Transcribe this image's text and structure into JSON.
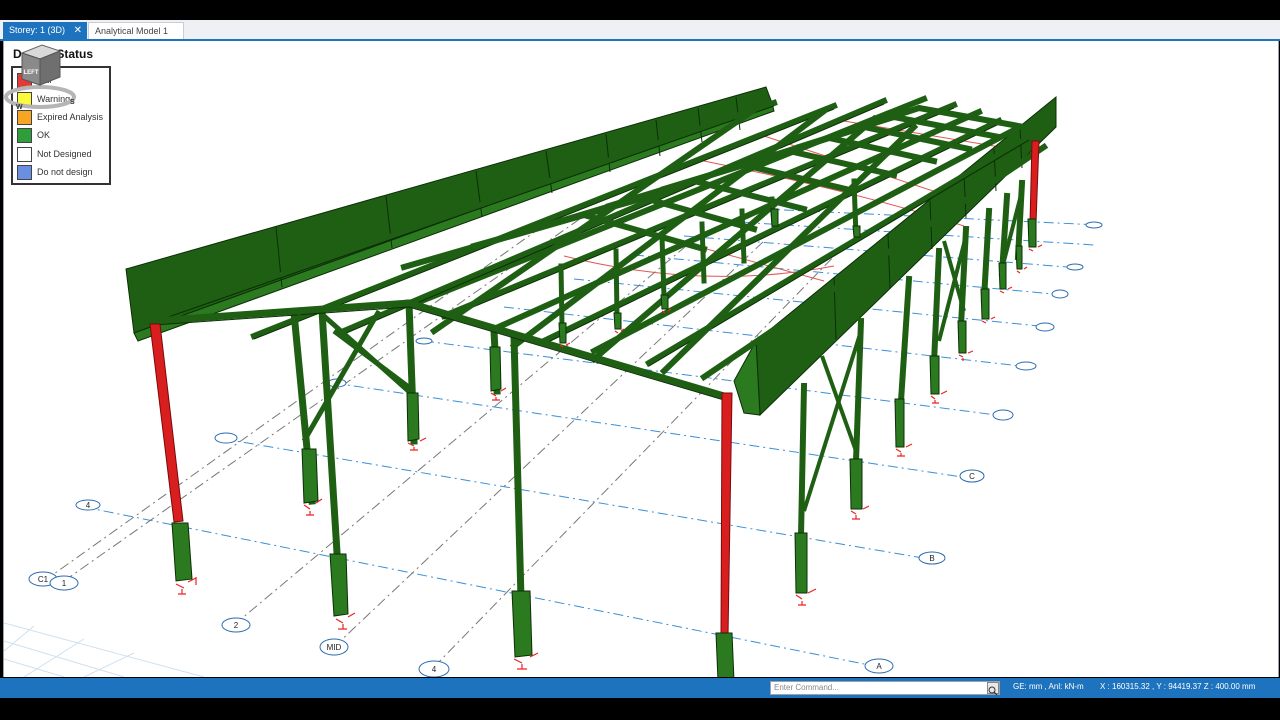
{
  "tabs": [
    {
      "label": "Storey: 1 (3D)",
      "active": true,
      "close_icon": "close-icon"
    },
    {
      "label": "Analytical Model 1",
      "active": false
    }
  ],
  "legend": {
    "title": "Design Status",
    "items": [
      {
        "label": "Fail",
        "color": "#e53935"
      },
      {
        "label": "Warning",
        "color": "#fbfb3c"
      },
      {
        "label": "Expired Analysis",
        "color": "#f6a623"
      },
      {
        "label": "OK",
        "color": "#2e9e3b"
      },
      {
        "label": "Not Designed",
        "color": "#ffffff"
      },
      {
        "label": "Do not design",
        "color": "#6b8fe0"
      }
    ]
  },
  "viewcube": {
    "face_label": "LEFT",
    "compass": [
      "W",
      "S"
    ]
  },
  "grid_labels": [
    "A",
    "B",
    "C",
    "1",
    "2",
    "4",
    "MID",
    "4",
    "C1"
  ],
  "statusbar": {
    "command_placeholder": "Enter Command...",
    "units": "GE: mm , Anl: kN-m",
    "coords": "X : 160315.32 , Y : 94419.37     Z : 400.00 mm"
  },
  "colors": {
    "member_ok": "#1f5f14",
    "member_fail": "#d81e1e",
    "accent": "#1e73be",
    "grid_line": "#3a8fd8"
  }
}
